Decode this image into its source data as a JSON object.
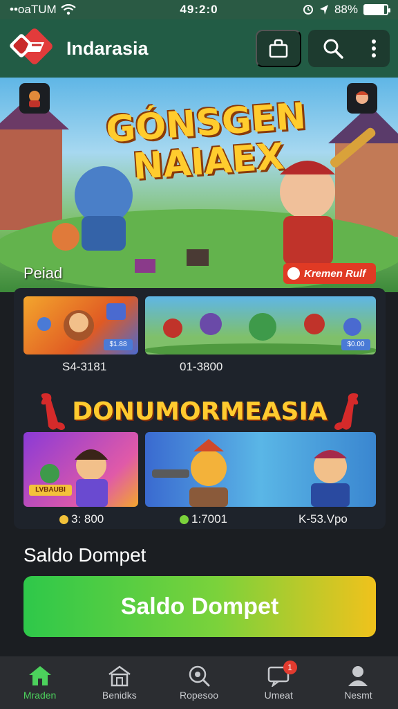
{
  "status_bar": {
    "carrier": "••oaTUM",
    "time": "49:2:0",
    "battery": "88%",
    "battery_level": 0.88
  },
  "header": {
    "app_title": "Indarasia",
    "icons": [
      "logo-icon",
      "bag-icon",
      "search-icon",
      "more-vert-icon"
    ]
  },
  "hero": {
    "title_line1": "GÓNSGEN",
    "title_line2": "NAIAEX",
    "section_label": "Peiad",
    "badge_label": "Kremen Rulf"
  },
  "games": {
    "row1": [
      {
        "price": "S4-3181",
        "tag": "$1.88"
      },
      {
        "price": "01-3800",
        "tag": "$0.00"
      }
    ],
    "promo_title": "DONUMORMEASIA",
    "row2": [
      {
        "price": "3: 800",
        "tag": "LVBAUBI"
      },
      {
        "price": "1:7001",
        "tag": ""
      },
      {
        "price": "K-53.Vpo",
        "tag": ""
      }
    ]
  },
  "wallet": {
    "heading": "Saldo Dompet",
    "button_label": "Saldo Dompet"
  },
  "bottom_nav": {
    "items": [
      {
        "label": "Mraden",
        "icon": "home-icon"
      },
      {
        "label": "Benidks",
        "icon": "store-icon"
      },
      {
        "label": "Ropesoo",
        "icon": "search-icon"
      },
      {
        "label": "Umeat",
        "icon": "message-icon",
        "badge": "1"
      },
      {
        "label": "Nesmt",
        "icon": "profile-icon"
      }
    ]
  },
  "colors": {
    "header_green": "#225c45",
    "accent_green": "#4cd15c",
    "background": "#1b1e22"
  }
}
